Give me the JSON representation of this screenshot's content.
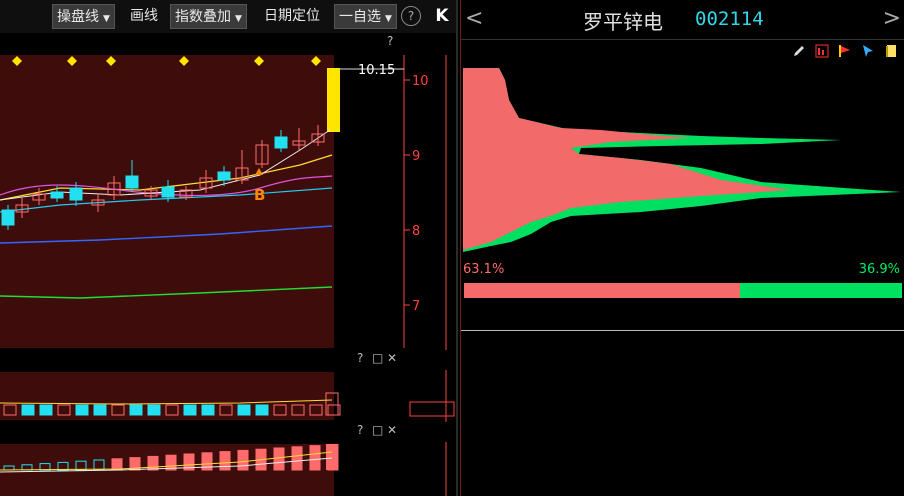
{
  "toolbar": {
    "tool_caopan": "操盘线",
    "tool_draw": "画线",
    "tool_index_overlay": "指数叠加",
    "tool_date_locate": "日期定位",
    "tool_watchlist": "一自选",
    "help": "?",
    "collapse": "K"
  },
  "main_chart": {
    "help": "?",
    "price_tag": "10.15",
    "buy_marker": "B",
    "y_ticks": [
      "10",
      "9",
      "8",
      "7"
    ],
    "y_values": [
      10,
      9,
      8,
      7
    ]
  },
  "sub1": {
    "help": "?",
    "restore": "□",
    "close": "✕"
  },
  "sub2": {
    "help": "?",
    "restore": "□",
    "close": "✕"
  },
  "right": {
    "prev": "<",
    "next": ">",
    "stock_name": "罗平锌电",
    "stock_code": "002114",
    "pct_left": "63.1%",
    "pct_right": "36.9%",
    "ratio_left": 0.631,
    "icons": [
      "pencil-icon",
      "chart-icon",
      "flag-icon",
      "cursor-icon",
      "book-icon"
    ]
  },
  "colors": {
    "bg": "#000000",
    "chart_bg": "#3f0c0c",
    "up": "#ff6b6b",
    "down": "#22e0f0",
    "green": "#00e060",
    "price_axis": "#ff4040",
    "highlight": "#ffe600"
  }
}
